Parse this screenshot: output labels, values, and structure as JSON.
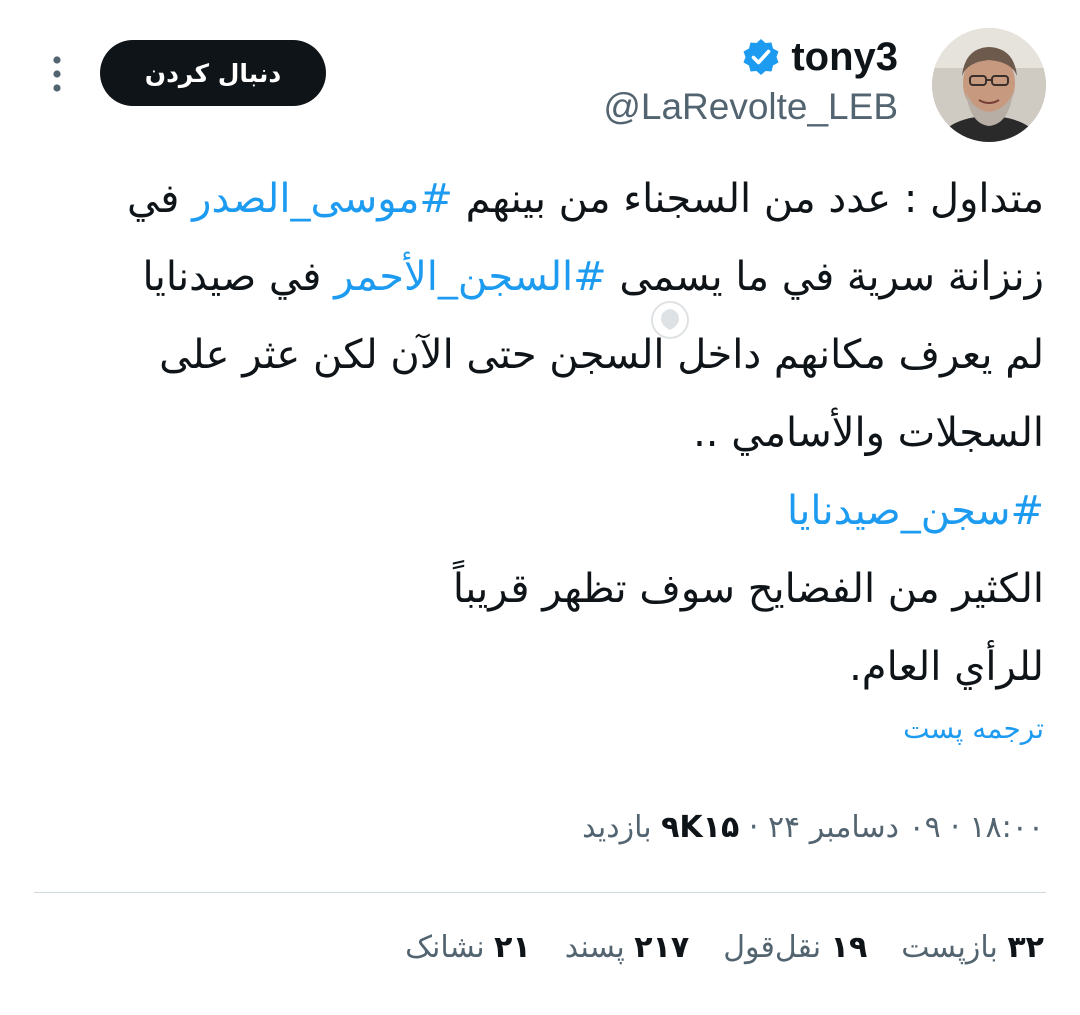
{
  "author": {
    "display_name": "tony3",
    "handle": "@LaRevolte_LEB",
    "verified_icon": "verified-badge-icon",
    "avatar_icon": "avatar"
  },
  "actions": {
    "follow_label": "دنبال کردن",
    "more_icon": "more-options-icon"
  },
  "tweet": {
    "line1": {
      "pre": "متداول : عدد من السجناء من بينهم ",
      "tag": "#موسى_الصدر",
      "post": " في"
    },
    "line2": {
      "pre": "زنزانة سرية في ما يسمى ",
      "tag": "#السجن_الأحمر",
      "post": "  في صيدنايا"
    },
    "line3": "لم يعرف مكانهم داخل السجن حتى الآن لكن عثر  على",
    "line4": "السجلات والأسامي ..",
    "line5_tag": "#سجن_صيدنايا",
    "line6": "الكثير من الفضايح سوف تظهر قريباً",
    "line7": "للرأي العام."
  },
  "translate_label": "ترجمه پست",
  "meta": {
    "time": "۱۸:۰۰",
    "date": "۰۹ دسامبر ۲۴",
    "separator": "·",
    "views_count": "۹K۱۵",
    "views_label": "بازدید"
  },
  "stats": {
    "reposts_count": "۳۲",
    "reposts_label": "بازپست",
    "quotes_count": "۱۹",
    "quotes_label": "نقل‌قول",
    "likes_count": "۲۱۷",
    "likes_label": "پسند",
    "bookmarks_count": "۲۱",
    "bookmarks_label": "نشانک"
  },
  "colors": {
    "text": "#0f1419",
    "secondary": "#536471",
    "accent": "#1d9bf0",
    "button_bg": "#0f1419",
    "divider": "#cfd9de"
  }
}
